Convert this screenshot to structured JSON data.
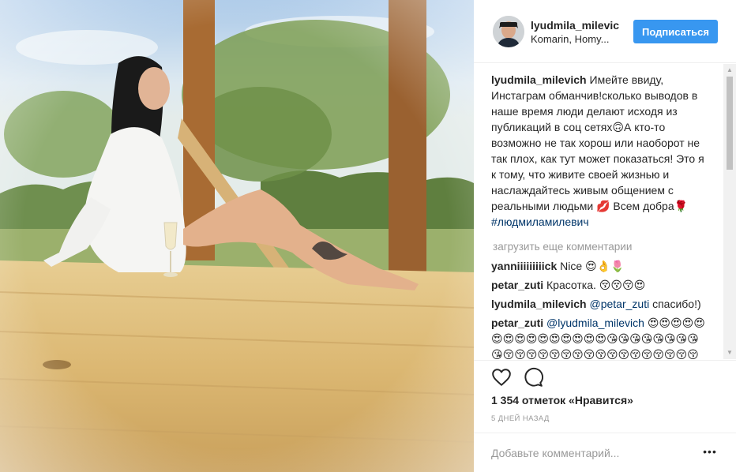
{
  "post": {
    "image_alt": "Woman in white shirt sitting on a wooden deck outdoors",
    "header": {
      "username": "lyudmila_milevich",
      "location": "Komarin, Homy...",
      "follow_label": "Подписаться",
      "avatar_icon": "avatar-photo"
    },
    "caption": {
      "user": "lyudmila_milevich",
      "text": "Имейте ввиду, Инстаграм обманчив!сколько выводов в наше время люди делают исходя из публикаций в соц сетях🙃А кто-то возможно не так хорош или наоборот не так плох, как тут может показаться! Это я к тому, что живите своей жизнью и наслаждайтесь живым общением с реальными людьми 💋 Всем добра🌹",
      "hashtag": "#людмиламилевич"
    },
    "load_more_label": "загрузить еще комментарии",
    "comments": [
      {
        "user": "yanniiiiiiiiick",
        "text": "Nice 😍👌🌷"
      },
      {
        "user": "petar_zuti",
        "text": "Красотка. 😚😚😚😍"
      },
      {
        "user": "lyudmila_milevich",
        "mention": "@petar_zuti",
        "text": "спасибо!)"
      },
      {
        "user": "petar_zuti",
        "mention": "@lyudmila_milevich",
        "text": "😍😍😍😍😍😍😍😍😍😍😍😍😍😍😍😘😘😘😘😘😘😘😘😘😚😚😚😚😚😚😚😚😚😚😚😚😚😚😚😚😚😚😚😚😚😚😚😚😚😚😚😚😚😚😚😚"
      }
    ],
    "actions": {
      "like_icon": "heart-outline",
      "comment_icon": "speech-bubble"
    },
    "likes_label": "1 354 отметок «Нравится»",
    "time_label": "5 дней назад",
    "add_comment_placeholder": "Добавьте комментарий...",
    "more_icon": "ellipsis"
  },
  "colors": {
    "follow_button": "#3897f0",
    "link": "#003569",
    "muted": "#999999"
  }
}
